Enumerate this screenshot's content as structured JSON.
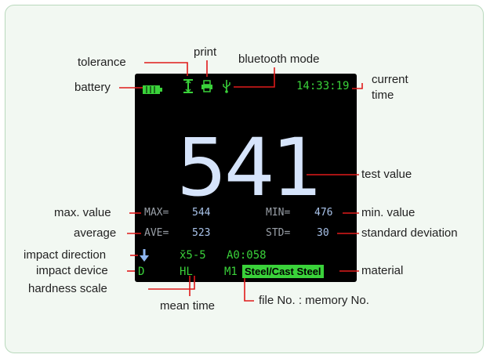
{
  "labels": {
    "tolerance": "tolerance",
    "print": "print",
    "bluetooth_mode": "bluetooth mode",
    "battery": "battery",
    "current_time": "current time",
    "test_value": "test value",
    "max_value": "max. value",
    "min_value": "min. value",
    "average": "average",
    "standard_deviation": "standard  deviation",
    "impact_direction": "impact  direction",
    "impact_device": "impact device",
    "material": "material",
    "hardness_scale": "hardness scale",
    "mean_time": "mean time",
    "file_memory": "file No. : memory No."
  },
  "screen": {
    "time": "14:33:19",
    "value": "541",
    "max_label": "MAX=",
    "max_value": "544",
    "min_label": "MIN=",
    "min_value": "476",
    "ave_label": "AVE=",
    "ave_value": "523",
    "std_label": "STD=",
    "std_value": "30",
    "mean_text": "x̄5-5",
    "file_text": "A0:058",
    "device": "D",
    "scale": "HL",
    "mem": "M1",
    "material": "Steel/Cast Steel"
  },
  "icons": [
    "battery-icon",
    "tolerance-icon",
    "printer-icon",
    "usb-icon",
    "arrow-down-icon"
  ],
  "colors": {
    "screen_bg": "#000000",
    "status_green": "#3ad23a",
    "value_blue": "#d6e4fb",
    "leader_red": "#e01a1a",
    "material_bg": "#3ad23a"
  }
}
